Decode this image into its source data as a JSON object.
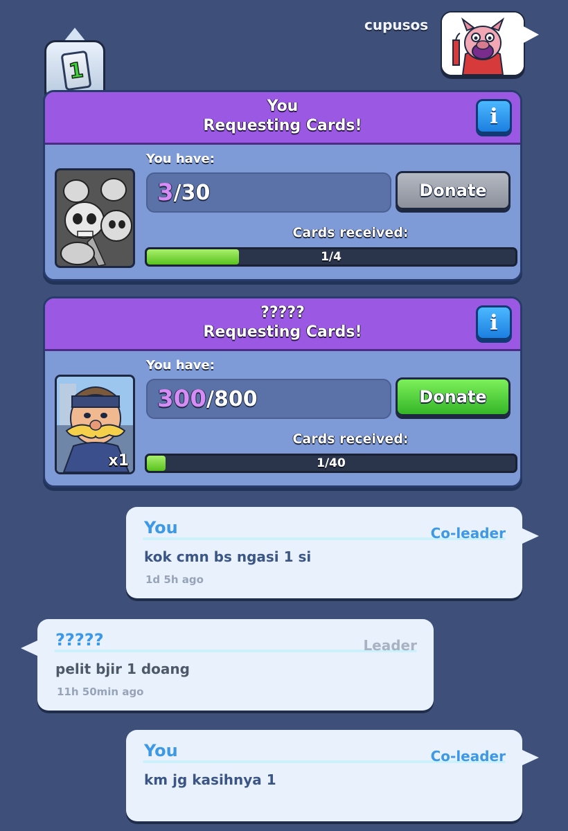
{
  "header": {
    "username": "cupusos",
    "avatar_icon": "pig-emote-with-firecracker-icon"
  },
  "level_badge": {
    "value": "1"
  },
  "requests": [
    {
      "title": "You",
      "subtitle": "Requesting Cards!",
      "info_label": "i",
      "you_have_label": "You have:",
      "have": "3",
      "max": "/30",
      "donate_label": "Donate",
      "donate_enabled": false,
      "received_label": "Cards received:",
      "progress_text": "1/4",
      "progress_fraction": 0.25,
      "card_icon": "skeleton-army-card-icon",
      "quantity": ""
    },
    {
      "title": "?????",
      "subtitle": "Requesting Cards!",
      "info_label": "i",
      "you_have_label": "You have:",
      "have": "300",
      "max": "/800",
      "donate_label": "Donate",
      "donate_enabled": true,
      "received_label": "Cards received:",
      "progress_text": "1/40",
      "progress_fraction": 0.025,
      "card_icon": "royal-giant-card-icon",
      "quantity": "x1"
    }
  ],
  "messages": [
    {
      "author": "You",
      "role": "Co-leader",
      "text": "kok cmn bs ngasi 1 si",
      "time": "1d 5h ago",
      "side": "right"
    },
    {
      "author": "?????",
      "role": "Leader",
      "text": "pelit bjir 1 doang",
      "time": "11h 50min ago",
      "side": "left"
    },
    {
      "author": "You",
      "role": "Co-leader",
      "text": "km jg kasihnya 1",
      "time": "",
      "side": "right"
    }
  ],
  "colors": {
    "background": "#3e5079",
    "panel_header": "#9b58e3",
    "panel_body": "#7f9bd7",
    "progress_fill": "#58c21d",
    "donate_green": "#35b628",
    "donate_gray": "#8b909a",
    "name_blue": "#3d98e6"
  }
}
